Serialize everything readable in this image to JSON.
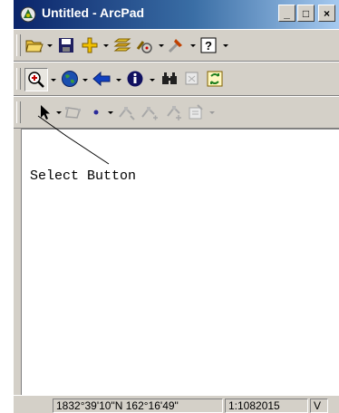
{
  "window": {
    "title": "Untitled - ArcPad",
    "minimize_glyph": "_",
    "maximize_glyph": "□",
    "close_glyph": "×"
  },
  "toolbar_main": {
    "items": [
      "open-folder-icon",
      "save-icon",
      "add-layer-icon",
      "layers-icon",
      "gps-icon",
      "tools-icon",
      "help-icon"
    ]
  },
  "toolbar_nav": {
    "items": [
      "zoom-in-icon",
      "globe-icon",
      "back-arrow-icon",
      "info-icon",
      "find-icon",
      "bookmark-icon",
      "refresh-icon"
    ]
  },
  "toolbar_edit": {
    "items": [
      "select-arrow-icon",
      "polygon-icon",
      "point-icon",
      "vertex-tool-icon",
      "add-vertex-icon",
      "move-feature-icon",
      "properties-icon"
    ]
  },
  "annotation": {
    "label": "Select Button"
  },
  "statusbar": {
    "coordinates": "1832°39'10\"N 162°16'49\"",
    "scale": "1:1082015",
    "extra": "V"
  },
  "colors": {
    "titlebar_start": "#0a246a",
    "titlebar_end": "#a6caf0",
    "chrome": "#d4d0c8"
  }
}
